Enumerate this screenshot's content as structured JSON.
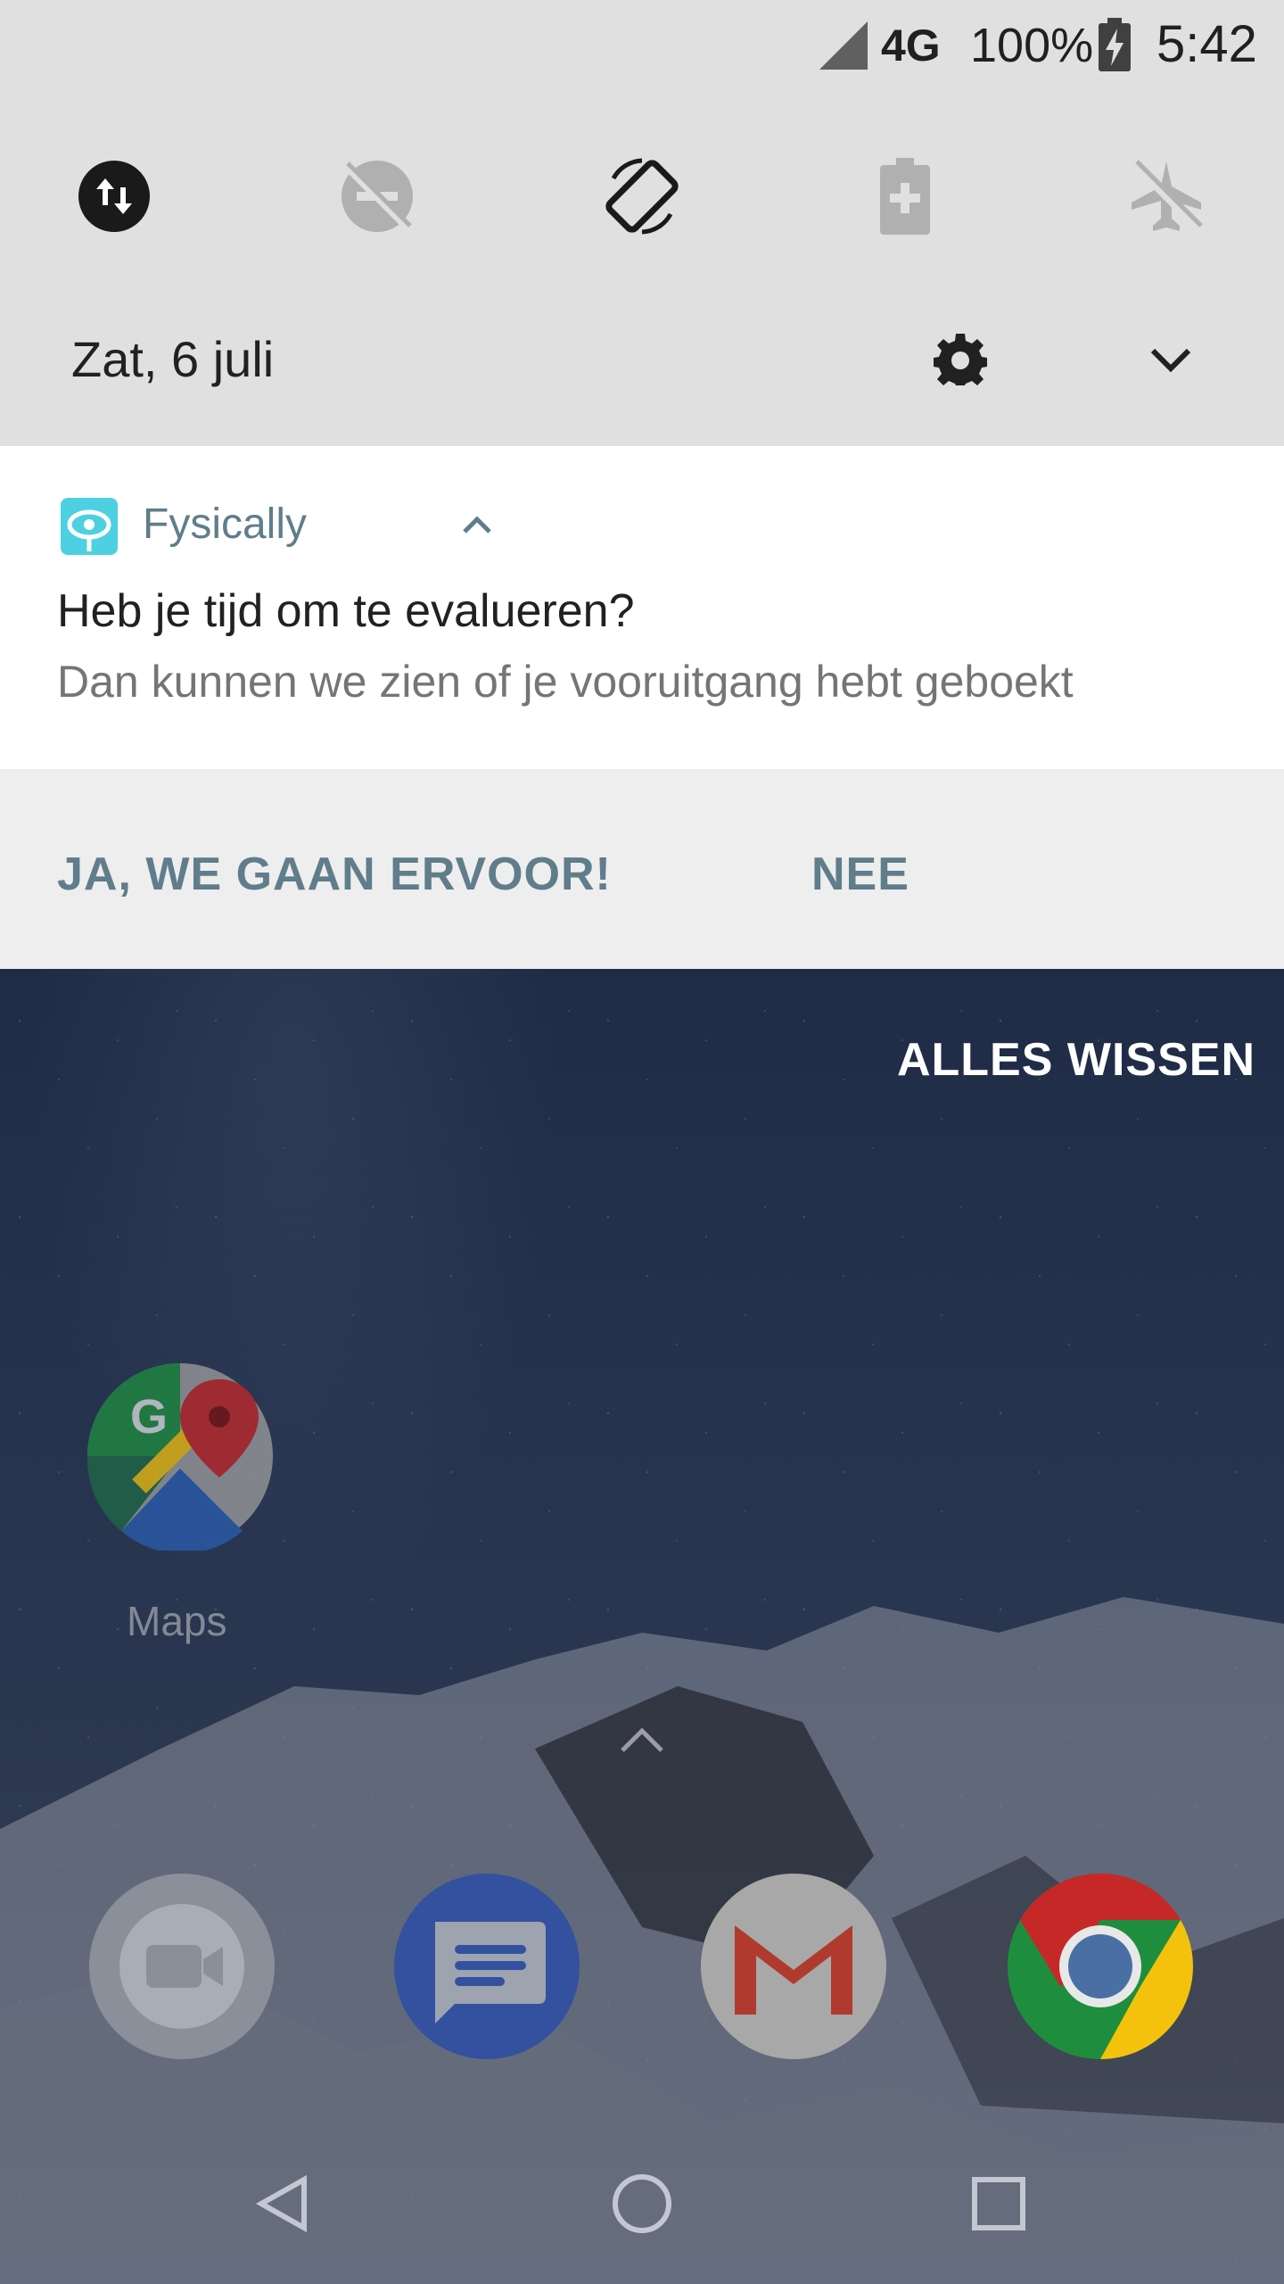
{
  "status_bar": {
    "network": "4G",
    "battery_percent": "100%",
    "time": "5:42",
    "icons": [
      "signal-icon",
      "battery-charging-icon"
    ]
  },
  "quick_settings": {
    "tiles": [
      {
        "name": "data-saver-icon",
        "active": true
      },
      {
        "name": "do-not-disturb-icon",
        "active": false
      },
      {
        "name": "auto-rotate-icon",
        "active": true
      },
      {
        "name": "battery-saver-icon",
        "active": false
      },
      {
        "name": "airplane-mode-icon",
        "active": false
      }
    ],
    "date": "Zat, 6 juli"
  },
  "notification": {
    "app_name": "Fysically",
    "title": "Heb je tijd om te evalueren?",
    "text": "Dan kunnen we zien of je vooruitgang hebt geboekt",
    "actions": {
      "yes": "JA, WE GAAN ERVOOR!",
      "no": "NEE"
    }
  },
  "home": {
    "clear_all": "ALLES WISSEN",
    "apps": [
      {
        "label": "Maps",
        "icon": "maps-icon"
      }
    ],
    "dock": [
      "duo-icon",
      "messages-icon",
      "gmail-icon",
      "chrome-icon"
    ]
  },
  "colors": {
    "shade_bg": "#e0e0e0",
    "accent": "#607d8b",
    "app_icon": "#4dd0e1"
  }
}
